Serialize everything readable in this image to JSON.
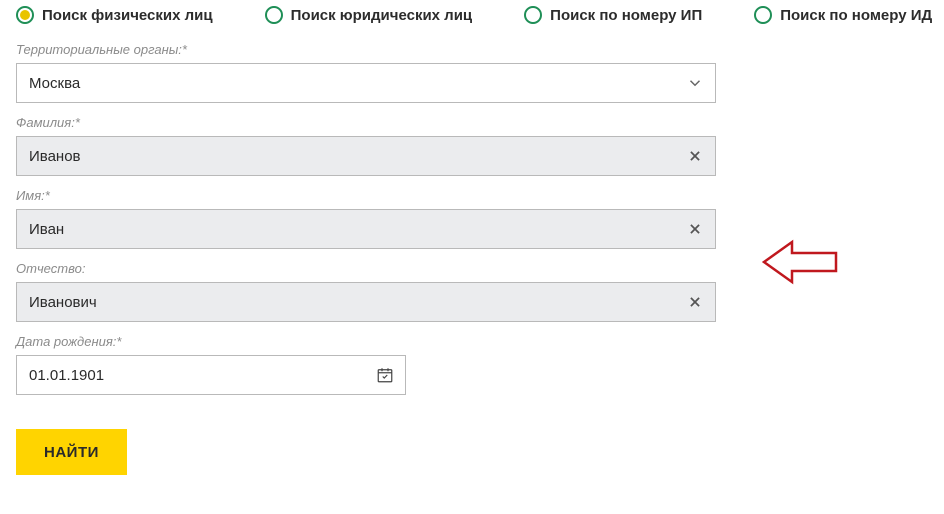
{
  "tabs": [
    {
      "label": "Поиск физических лиц",
      "selected": true
    },
    {
      "label": "Поиск юридических лиц",
      "selected": false
    },
    {
      "label": "Поиск по номеру ИП",
      "selected": false
    },
    {
      "label": "Поиск по номеру ИД",
      "selected": false
    }
  ],
  "form": {
    "region": {
      "label": "Территориальные органы:*",
      "value": "Москва"
    },
    "surname": {
      "label": "Фамилия:*",
      "value": "Иванов"
    },
    "name": {
      "label": "Имя:*",
      "value": "Иван"
    },
    "patronym": {
      "label": "Отчество:",
      "value": "Иванович"
    },
    "birth": {
      "label": "Дата рождения:*",
      "value": "01.01.1901"
    },
    "submit": "НАЙТИ"
  }
}
